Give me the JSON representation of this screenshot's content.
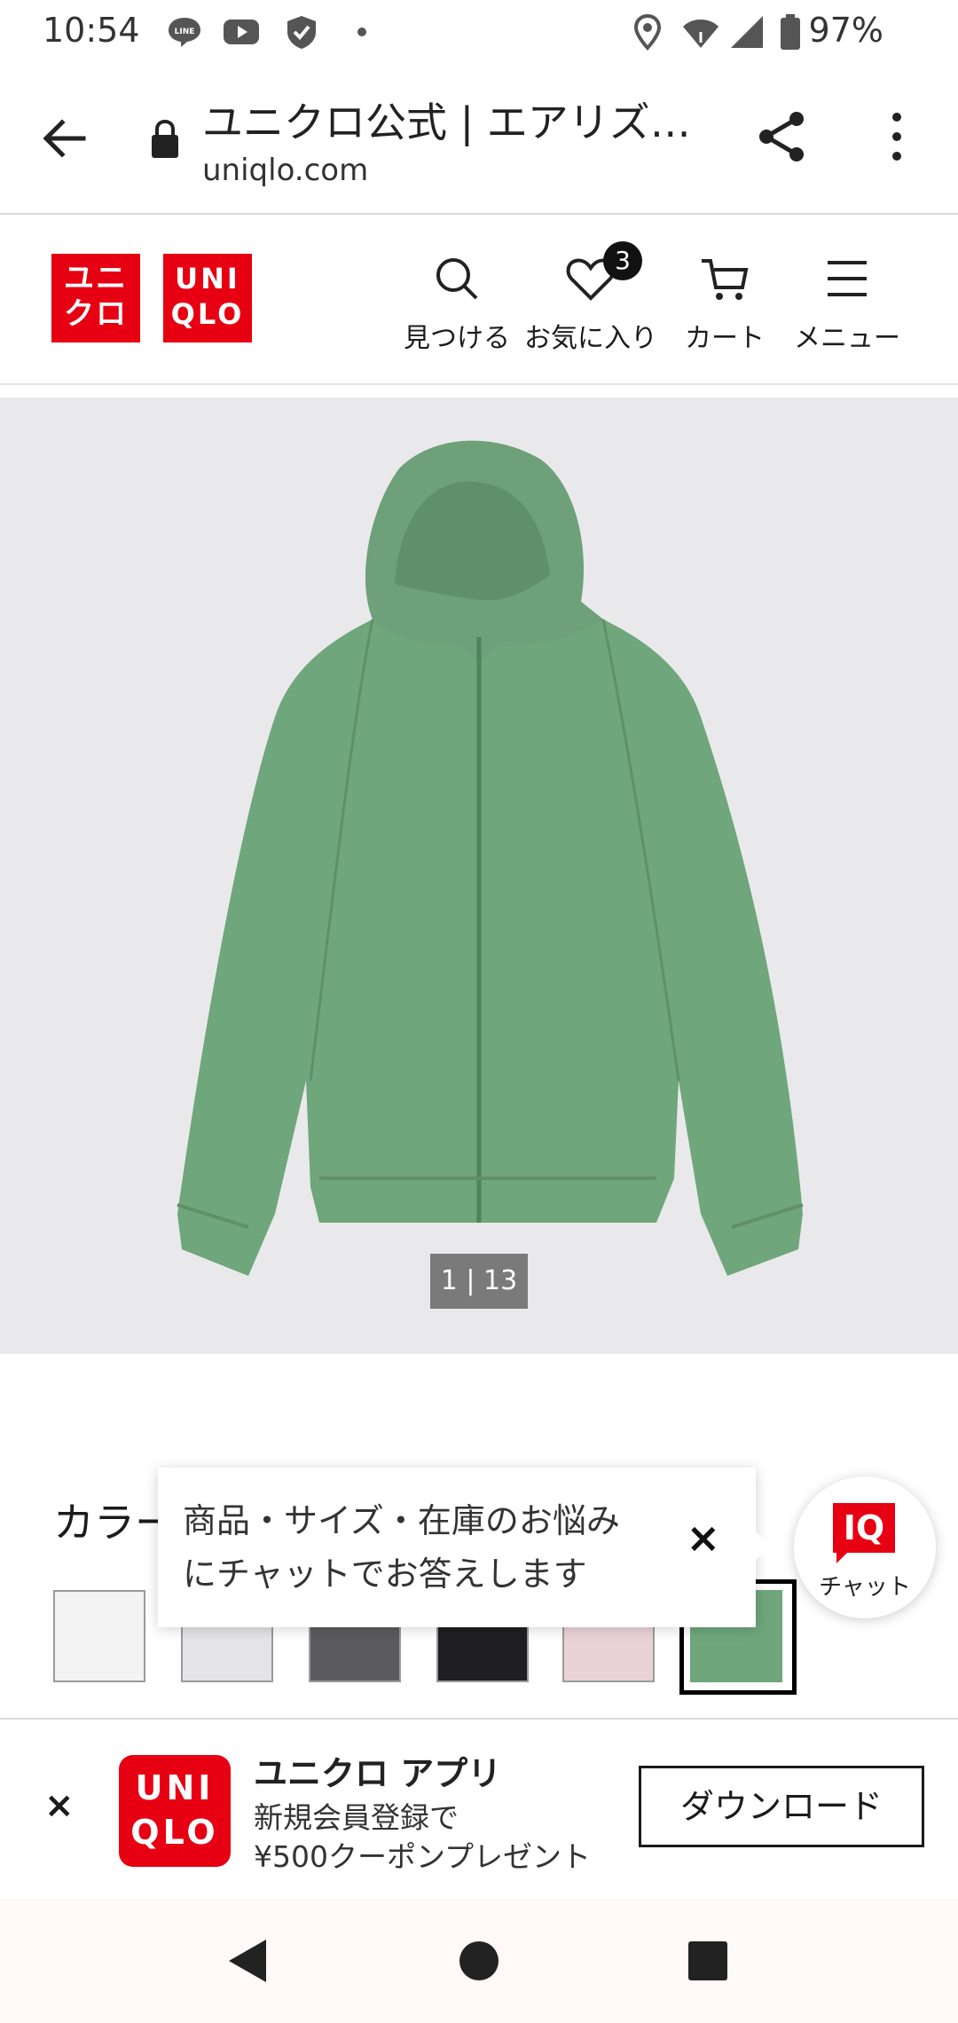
{
  "status_bar": {
    "time": "10:54",
    "battery": "97%",
    "icons": [
      "line-icon",
      "youtube-icon",
      "shield-check-icon",
      "dot-icon",
      "location-icon",
      "wifi-icon",
      "signal-icon",
      "battery-icon"
    ]
  },
  "browser": {
    "title": "ユニクロ公式 | エアリズ…",
    "host": "uniqlo.com",
    "icons": [
      "back-arrow-icon",
      "lock-icon",
      "share-icon",
      "more-vert-icon"
    ]
  },
  "header": {
    "logo_ja": [
      "ユニ",
      "クロ"
    ],
    "logo_en": [
      "UNI",
      "QLO"
    ],
    "nav": [
      {
        "label": "見つける",
        "icon": "search-icon"
      },
      {
        "label": "お気に入り",
        "icon": "heart-icon",
        "badge": "3"
      },
      {
        "label": "カート",
        "icon": "cart-icon"
      },
      {
        "label": "メニュー",
        "icon": "hamburger-icon"
      }
    ]
  },
  "product": {
    "image_counter": "1 | 13",
    "color_label": "カラー",
    "swatches": [
      {
        "color": "#f3f3f3"
      },
      {
        "color": "#e4e4e6"
      },
      {
        "color": "#5b5b5e"
      },
      {
        "color": "#1f1f22"
      },
      {
        "color": "#e9d3d9"
      },
      {
        "color": "#6fa67b",
        "selected": true
      }
    ]
  },
  "chat": {
    "tooltip_line1": "商品・サイズ・在庫のお悩み",
    "tooltip_line2": "にチャットでお答えします",
    "close": "×",
    "button_logo": "IQ",
    "button_label": "チャット"
  },
  "app_banner": {
    "close": "×",
    "logo": [
      "UNI",
      "QLO"
    ],
    "title": "ユニクロ アプリ",
    "subtitle_1": "新規会員登録で",
    "subtitle_2": "¥500クーポンプレゼント",
    "download": "ダウンロード"
  },
  "colors": {
    "brand_red": "#e60012",
    "product_green": "#6fa67b"
  }
}
